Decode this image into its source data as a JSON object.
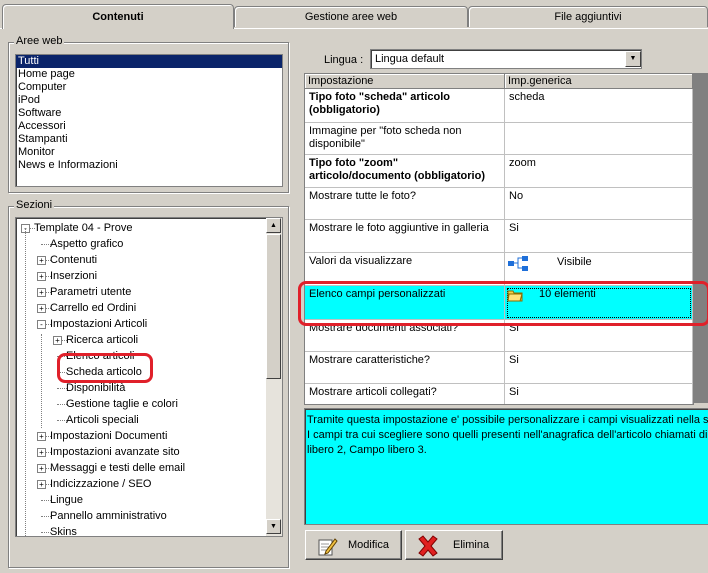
{
  "tabs": [
    "Contenuti",
    "Gestione aree web",
    "File aggiuntivi"
  ],
  "aree_web": {
    "title": "Aree web",
    "items": [
      "Tutti",
      "Home page",
      "Computer",
      "iPod",
      "Software",
      "Accessori",
      "Stampanti",
      "Monitor",
      "News e Informazioni"
    ],
    "selected": "Tutti"
  },
  "sezioni": {
    "title": "Sezioni",
    "tree": [
      {
        "label": "Template 04 - Prove",
        "level": 0,
        "expander": "-"
      },
      {
        "label": "Aspetto grafico",
        "level": 1,
        "expander": ""
      },
      {
        "label": "Contenuti",
        "level": 1,
        "expander": "+"
      },
      {
        "label": "Inserzioni",
        "level": 1,
        "expander": "+"
      },
      {
        "label": "Parametri utente",
        "level": 1,
        "expander": "+"
      },
      {
        "label": "Carrello ed Ordini",
        "level": 1,
        "expander": "+"
      },
      {
        "label": "Impostazioni Articoli",
        "level": 1,
        "expander": "-"
      },
      {
        "label": "Ricerca articoli",
        "level": 2,
        "expander": "+"
      },
      {
        "label": "Elenco articoli",
        "level": 2,
        "expander": ""
      },
      {
        "label": "Scheda articolo",
        "level": 2,
        "expander": ""
      },
      {
        "label": "Disponibilità",
        "level": 2,
        "expander": ""
      },
      {
        "label": "Gestione taglie e colori",
        "level": 2,
        "expander": ""
      },
      {
        "label": "Articoli speciali",
        "level": 2,
        "expander": ""
      },
      {
        "label": "Impostazioni Documenti",
        "level": 1,
        "expander": "+"
      },
      {
        "label": "Impostazioni avanzate sito",
        "level": 1,
        "expander": "+"
      },
      {
        "label": "Messaggi e testi delle email",
        "level": 1,
        "expander": "+"
      },
      {
        "label": "Indicizzazione / SEO",
        "level": 1,
        "expander": "+"
      },
      {
        "label": "Lingue",
        "level": 1,
        "expander": ""
      },
      {
        "label": "Pannello amministrativo",
        "level": 1,
        "expander": ""
      },
      {
        "label": "Skins",
        "level": 1,
        "expander": ""
      }
    ]
  },
  "lingua": {
    "label": "Lingua :",
    "value": "Lingua default"
  },
  "grid": {
    "headers": [
      "Impostazione",
      "Imp.generica"
    ],
    "rows": [
      {
        "setting": "Tipo foto \"scheda\" articolo (obbligatorio)",
        "value": "scheda",
        "bold": true
      },
      {
        "setting": "Immagine per \"foto scheda non disponibile\"",
        "value": "",
        "bold": false
      },
      {
        "setting": "Tipo foto \"zoom\" articolo/documento (obbligatorio)",
        "value": "zoom",
        "bold": true
      },
      {
        "setting": "Mostrare tutte le foto?",
        "value": "No",
        "bold": false
      },
      {
        "setting": "Mostrare le foto aggiuntive in galleria",
        "value": "Si",
        "bold": false
      },
      {
        "setting": "Valori da visualizzare",
        "value": "Visibile",
        "bold": false,
        "icon": "hierarchy-icon"
      },
      {
        "setting": "Elenco campi personalizzati",
        "value": "10 elementi",
        "bold": false,
        "icon": "folder-icon",
        "selected": true
      },
      {
        "setting": "Mostrare documenti associati?",
        "value": "Si",
        "bold": false
      },
      {
        "setting": "Mostrare caratteristiche?",
        "value": "Si",
        "bold": false
      },
      {
        "setting": "Mostrare articoli collegati?",
        "value": "Si",
        "bold": false
      }
    ]
  },
  "description": {
    "lines": [
      "Tramite questa impostazione e' possibile personalizzare i campi visualizzati nella sch",
      "I campi tra cui scegliere sono quelli presenti nell'anagrafica dell'articolo chiamati di de",
      "libero 2, Campo libero 3."
    ]
  },
  "buttons": {
    "modifica": "Modifica",
    "elimina": "Elimina"
  },
  "colors": {
    "selection": "#0a246a",
    "highlight_cyan": "#00ffff",
    "annotation_red": "#e0202a"
  }
}
